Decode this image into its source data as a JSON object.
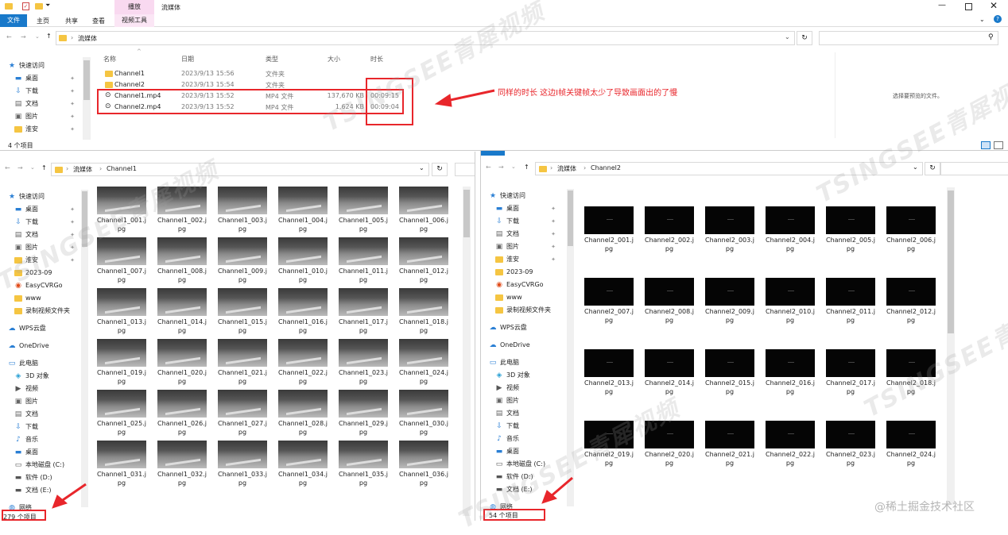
{
  "top": {
    "ribbon_tabs": [
      "文件",
      "主页",
      "共享",
      "查看"
    ],
    "context_group": "播放",
    "context_tab": "视频工具",
    "title": "流媒体",
    "breadcrumb": [
      "流媒体"
    ],
    "columns": {
      "name": "名称",
      "date": "日期",
      "type": "类型",
      "size": "大小",
      "duration": "时长"
    },
    "files": [
      {
        "name": "Channel1",
        "date": "2023/9/13 15:56",
        "type": "文件夹",
        "size": "",
        "duration": ""
      },
      {
        "name": "Channel2",
        "date": "2023/9/13 15:54",
        "type": "文件夹",
        "size": "",
        "duration": ""
      },
      {
        "name": "Channel1.mp4",
        "date": "2023/9/13 15:52",
        "type": "MP4 文件",
        "size": "137,670 KB",
        "duration": "00:09:15"
      },
      {
        "name": "Channel2.mp4",
        "date": "2023/9/13 15:52",
        "type": "MP4 文件",
        "size": "1,624 KB",
        "duration": "00:09:04"
      }
    ],
    "nav": [
      "快速访问",
      "桌面",
      "下载",
      "文档",
      "图片",
      "淮安"
    ],
    "status": "4 个项目",
    "preview_hint": "选择要预览的文件。"
  },
  "annotation": "同样的时长 这边I帧关键帧太少了导致画面出的了慢",
  "left": {
    "breadcrumb": [
      "流媒体",
      "Channel1"
    ],
    "nav": [
      "快速访问",
      "桌面",
      "下载",
      "文档",
      "图片",
      "淮安",
      "2023-09",
      "EasyCVRGo",
      "www",
      "录制视频文件夹",
      "WPS云盘",
      "OneDrive",
      "此电脑",
      "3D 对象",
      "视频",
      "图片",
      "文档",
      "下载",
      "音乐",
      "桌面",
      "本地磁盘 (C:)",
      "软件 (D:)",
      "文档 (E:)",
      "网络"
    ],
    "thumbs": [
      "Channel1_001.jpg",
      "Channel1_002.jpg",
      "Channel1_003.jpg",
      "Channel1_004.jpg",
      "Channel1_005.jpg",
      "Channel1_006.jpg",
      "Channel1_007.jpg",
      "Channel1_008.jpg",
      "Channel1_009.jpg",
      "Channel1_010.jpg",
      "Channel1_011.jpg",
      "Channel1_012.jpg",
      "Channel1_013.jpg",
      "Channel1_014.jpg",
      "Channel1_015.jpg",
      "Channel1_016.jpg",
      "Channel1_017.jpg",
      "Channel1_018.jpg",
      "Channel1_019.jpg",
      "Channel1_020.jpg",
      "Channel1_021.jpg",
      "Channel1_022.jpg",
      "Channel1_023.jpg",
      "Channel1_024.jpg",
      "Channel1_025.jpg",
      "Channel1_026.jpg",
      "Channel1_027.jpg",
      "Channel1_028.jpg",
      "Channel1_029.jpg",
      "Channel1_030.jpg",
      "Channel1_031.jpg",
      "Channel1_032.jpg",
      "Channel1_033.jpg",
      "Channel1_034.jpg",
      "Channel1_035.jpg",
      "Channel1_036.jpg"
    ],
    "status": "279 个项目"
  },
  "right": {
    "breadcrumb": [
      "流媒体",
      "Channel2"
    ],
    "nav": [
      "快速访问",
      "桌面",
      "下载",
      "文档",
      "图片",
      "淮安",
      "2023-09",
      "EasyCVRGo",
      "www",
      "录制视频文件夹",
      "WPS云盘",
      "OneDrive",
      "此电脑",
      "3D 对象",
      "视频",
      "图片",
      "文档",
      "下载",
      "音乐",
      "桌面",
      "本地磁盘 (C:)",
      "软件 (D:)",
      "文档 (E:)",
      "网络"
    ],
    "thumbs": [
      "Channel2_001.jpg",
      "Channel2_002.jpg",
      "Channel2_003.jpg",
      "Channel2_004.jpg",
      "Channel2_005.jpg",
      "Channel2_006.jpg",
      "Channel2_007.jpg",
      "Channel2_008.jpg",
      "Channel2_009.jpg",
      "Channel2_010.jpg",
      "Channel2_011.jpg",
      "Channel2_012.jpg",
      "Channel2_013.jpg",
      "Channel2_014.jpg",
      "Channel2_015.jpg",
      "Channel2_016.jpg",
      "Channel2_017.jpg",
      "Channel2_018.jpg",
      "Channel2_019.jpg",
      "Channel2_020.jpg",
      "Channel2_021.jpg",
      "Channel2_022.jpg",
      "Channel2_023.jpg",
      "Channel2_024.jpg"
    ],
    "status": "54 个项目"
  },
  "watermark": "TSINGSEE青犀视频",
  "credit": "@稀土掘金技术社区",
  "colors": {
    "accent": "#1979ca",
    "annotation": "#e8262b",
    "folder": "#f5c542",
    "context_tab_bg": "#f9d9f0"
  }
}
